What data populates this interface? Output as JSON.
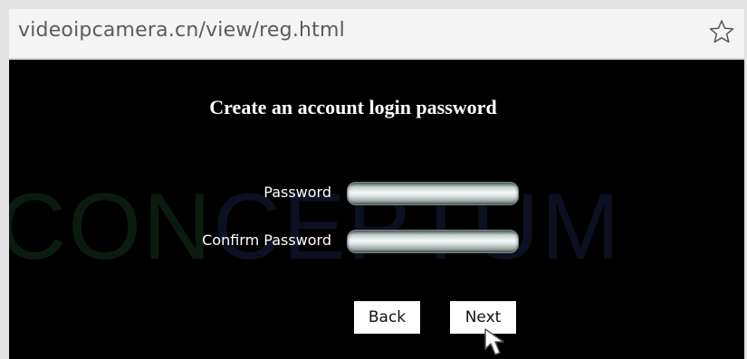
{
  "browser": {
    "url": "videoipcamera.cn/view/reg.html",
    "bookmark_icon": "star-outline-icon"
  },
  "page": {
    "watermark_a": "CON",
    "watermark_b": "CEPTUM",
    "title": "Create an account login password",
    "password_label": "Password",
    "confirm_label": "Confirm Password",
    "password_value": "",
    "confirm_value": "",
    "back_label": "Back",
    "next_label": "Next",
    "cursor_icon": "mouse-pointer-icon"
  },
  "colors": {
    "background": "#000000",
    "text": "#ffffff",
    "button_bg": "#ffffff"
  }
}
